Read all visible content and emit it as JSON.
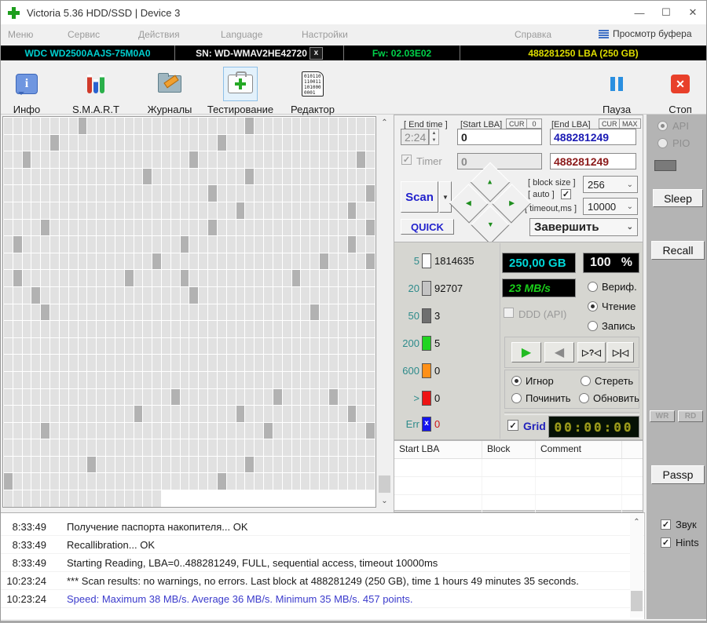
{
  "window": {
    "title": "Victoria 5.36 HDD/SSD | Device 3",
    "minimize": "—",
    "maximize": "☐",
    "close": "✕"
  },
  "menu": {
    "items": [
      "Меню",
      "Сервис",
      "Действия",
      "Language",
      "Настройки",
      "Справка"
    ],
    "buffer_view_label": "Просмотр буфера"
  },
  "device_bar": {
    "model": "WDC WD2500AAJS-75M0A0",
    "serial": "SN: WD-WMAV2HE42720",
    "serial_close": "x",
    "firmware": "Fw: 02.03E02",
    "capacity": "488281250 LBA (250 GB)"
  },
  "toolbar": {
    "info": "Инфо",
    "smart": "S.M.A.R.T",
    "journals": "Журналы",
    "testing": "Тестирование",
    "editor": "Редактор",
    "pause": "Пауза",
    "stop": "Стоп",
    "editor_icon_lines": [
      "010110",
      "110011",
      "101000",
      "0001"
    ]
  },
  "scan_map": {
    "cols": 40,
    "rows": 23,
    "last_row_cells": 17,
    "cell_color": "#e1e1e1",
    "slow_color": "#b2b2b2",
    "slow_cells": [
      [
        0,
        8
      ],
      [
        0,
        26
      ],
      [
        1,
        5
      ],
      [
        1,
        23
      ],
      [
        2,
        2
      ],
      [
        2,
        20
      ],
      [
        2,
        38
      ],
      [
        3,
        15
      ],
      [
        3,
        26
      ],
      [
        4,
        22
      ],
      [
        4,
        39
      ],
      [
        5,
        25
      ],
      [
        5,
        37
      ],
      [
        6,
        4
      ],
      [
        6,
        22
      ],
      [
        6,
        39
      ],
      [
        7,
        1
      ],
      [
        7,
        19
      ],
      [
        7,
        37
      ],
      [
        8,
        16
      ],
      [
        8,
        34
      ],
      [
        8,
        39
      ],
      [
        9,
        1
      ],
      [
        9,
        13
      ],
      [
        9,
        19
      ],
      [
        9,
        31
      ],
      [
        10,
        3
      ],
      [
        10,
        20
      ],
      [
        11,
        4
      ],
      [
        11,
        33
      ],
      [
        16,
        18
      ],
      [
        16,
        29
      ],
      [
        16,
        35
      ],
      [
        17,
        14
      ],
      [
        17,
        25
      ],
      [
        17,
        37
      ],
      [
        18,
        4
      ],
      [
        18,
        28
      ],
      [
        18,
        39
      ],
      [
        20,
        9
      ],
      [
        20,
        26
      ],
      [
        21,
        0
      ],
      [
        21,
        23
      ]
    ]
  },
  "test_controls": {
    "end_time_label": "[ End time ]",
    "end_time_value": "2:24",
    "start_lba_label": "[Start LBA]",
    "cur_button": "CUR",
    "zero_button": "0",
    "end_lba_label": "[End LBA]",
    "max_button": "MAX",
    "start_lba_value": "0",
    "end_lba_value": "488281249",
    "timer_label": "Timer",
    "timer_start_value": "0",
    "timer_end_value": "488281249",
    "scan_button": "Scan",
    "quick_button": "QUICK",
    "block_size_label": "[ block size ]",
    "block_size_value": "256",
    "auto_label": "[ auto ]",
    "timeout_label": "[ timeout,ms ]",
    "timeout_value": "10000",
    "finish_action": "Завершить"
  },
  "stats": {
    "rows": [
      {
        "label": "5",
        "value": "1814635",
        "color": "#fdfdfd",
        "glyph": "",
        "value_color": "#111111"
      },
      {
        "label": "20",
        "value": "92707",
        "color": "#c4c4c4",
        "glyph": "",
        "value_color": "#111111"
      },
      {
        "label": "50",
        "value": "3",
        "color": "#6f6f6f",
        "glyph": "",
        "value_color": "#111111"
      },
      {
        "label": "200",
        "value": "5",
        "color": "#21d421",
        "glyph": "",
        "value_color": "#111111"
      },
      {
        "label": "600",
        "value": "0",
        "color": "#ff9018",
        "glyph": "",
        "value_color": "#111111"
      },
      {
        "label": ">",
        "value": "0",
        "color": "#ee1414",
        "glyph": "",
        "value_color": "#111111"
      },
      {
        "label": "Err",
        "value": "0",
        "color": "#1414ee",
        "glyph": "x",
        "value_color": "#cc1414"
      }
    ]
  },
  "status": {
    "size": "250,00 GB",
    "size_color": "#00d8d8",
    "percent": "100",
    "percent_unit": "%",
    "speed": "23 MB/s",
    "speed_color": "#1ad01a",
    "ddd_label": "DDD (API)",
    "mode_options": [
      "Вериф.",
      "Чтение",
      "Запись"
    ],
    "action_options": [
      "Игнор",
      "Стереть",
      "Починить",
      "Обновить"
    ],
    "grid_label": "Grid",
    "timer_display": "00:00:00"
  },
  "defect_table": {
    "headers": [
      "Start LBA",
      "Block",
      "Comment"
    ]
  },
  "side_panel": {
    "api": "API",
    "pio": "PIO",
    "sleep": "Sleep",
    "recall": "Recall",
    "wr": "WR",
    "rd": "RD",
    "passp": "Passp",
    "sound": "Звук",
    "hints": "Hints"
  },
  "log": {
    "entries": [
      {
        "time": "8:33:49",
        "text": "Получение паспорта накопителя... OK",
        "color": "#1a1a1a"
      },
      {
        "time": "8:33:49",
        "text": "Recallibration... OK",
        "color": "#1a1a1a"
      },
      {
        "time": "8:33:49",
        "text": "Starting Reading, LBA=0..488281249, FULL, sequential access, timeout 10000ms",
        "color": "#1a1a1a"
      },
      {
        "time": "10:23:24",
        "text": "*** Scan results: no warnings, no errors. Last block at 488281249 (250 GB), time 1 hours 49 minutes 35 seconds.",
        "color": "#1a1a1a"
      },
      {
        "time": "10:23:24",
        "text": "Speed: Maximum 38 MB/s. Average 36 MB/s. Minimum 35 MB/s. 457 points.",
        "color": "#3b3bcc"
      }
    ]
  }
}
